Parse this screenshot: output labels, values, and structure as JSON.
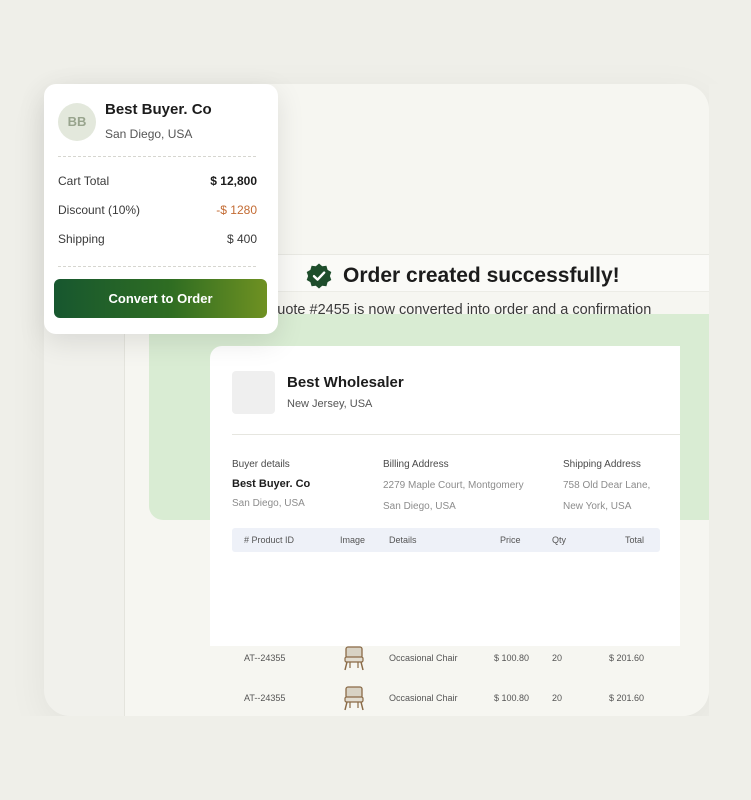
{
  "summary": {
    "avatar_initials": "BB",
    "buyer_name": "Best Buyer. Co",
    "buyer_location": "San Diego, USA",
    "rows": [
      {
        "label": "Cart Total",
        "value": "$ 12,800"
      },
      {
        "label": "Discount (10%)",
        "value": "-$ 1280"
      },
      {
        "label": "Shipping",
        "value": "$ 400"
      }
    ],
    "button_label": "Convert to Order",
    "accent_colors": {
      "button_start": "#17572f",
      "button_end": "#6f9122",
      "discount": "#c36b33"
    }
  },
  "success": {
    "title": "Order created successfully!",
    "subtitle": "Quote #2455 is now converted into order and a confirmation",
    "icon": "verified-badge-icon",
    "banner_color": "#d9ecd3"
  },
  "order": {
    "supplier_name": "Best Wholesaler",
    "supplier_location": "New Jersey, USA",
    "buyer_details": {
      "label": "Buyer details",
      "name": "Best Buyer. Co",
      "location": "San Diego, USA"
    },
    "billing": {
      "label": "Billing Address",
      "line1": "2279 Maple Court, Montgomery",
      "line2": "San Diego, USA"
    },
    "shipping": {
      "label": "Shipping Address",
      "line1": "758 Old Dear Lane,",
      "line2": "New York, USA"
    },
    "table": {
      "headers": [
        "# Product ID",
        "Image",
        "Details",
        "Price",
        "Qty",
        "Total"
      ],
      "rows": [
        {
          "id": "AT--24355",
          "image": "chair-image",
          "details": "Occasional Chair",
          "price": "$ 100.80",
          "qty": "20",
          "total": "$ 201.60"
        },
        {
          "id": "AT--24355",
          "image": "chair-image",
          "details": "Occasional Chair",
          "price": "$ 100.80",
          "qty": "20",
          "total": "$ 201.60"
        }
      ]
    }
  }
}
